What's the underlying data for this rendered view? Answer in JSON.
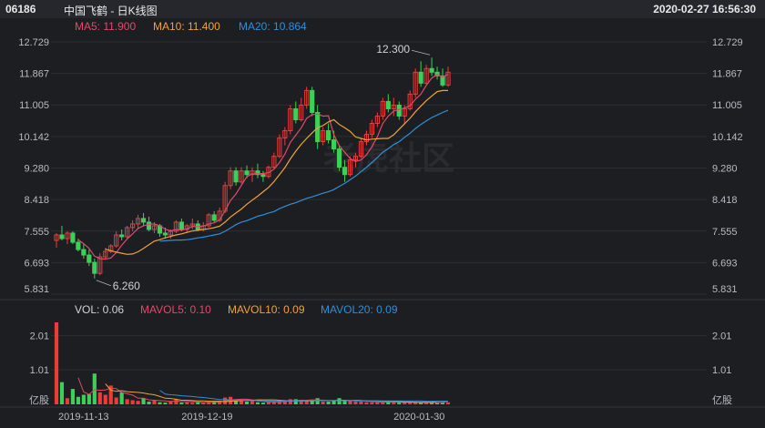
{
  "header": {
    "code": "06186",
    "name": "中国飞鹤 - 日K线图",
    "datetime": "2020-02-27 16:56:30"
  },
  "watermark": "老虎社区",
  "ma_legend": [
    {
      "label": "MA5: 11.900",
      "color": "#e04a6a"
    },
    {
      "label": "MA10: 11.400",
      "color": "#f0a23a"
    },
    {
      "label": "MA20: 10.864",
      "color": "#2f8fd8"
    }
  ],
  "vol_legend": [
    {
      "label": "VOL: 0.06",
      "color": "#cfd3da"
    },
    {
      "label": "MAVOL5: 0.10",
      "color": "#e04a6a"
    },
    {
      "label": "MAVOL10: 0.09",
      "color": "#f0a23a"
    },
    {
      "label": "MAVOL20: 0.09",
      "color": "#2f8fd8"
    }
  ],
  "colors": {
    "up": "#f03a3a",
    "down": "#3ccf5a",
    "grid": "#2c2e33"
  },
  "chart_data": [
    {
      "type": "candlestick",
      "ylim": [
        5.831,
        12.729
      ],
      "yticks": [
        "12.729",
        "11.867",
        "11.005",
        "10.142",
        "9.280",
        "8.418",
        "7.555",
        "6.693",
        "5.831"
      ],
      "xticks": [
        "2019-11-13",
        "2019-12-19",
        "2020-01-30"
      ],
      "annotations": [
        {
          "label": "12.300",
          "index": 69,
          "value": 12.3
        },
        {
          "label": "6.260",
          "index": 7,
          "value": 6.26
        }
      ],
      "ohlc": [
        [
          7.3,
          7.5,
          7.1,
          7.45
        ],
        [
          7.45,
          7.7,
          7.3,
          7.35
        ],
        [
          7.35,
          7.55,
          7.2,
          7.5
        ],
        [
          7.5,
          7.55,
          7.2,
          7.25
        ],
        [
          7.25,
          7.35,
          7.0,
          7.05
        ],
        [
          7.05,
          7.2,
          6.8,
          6.9
        ],
        [
          6.9,
          7.05,
          6.6,
          6.7
        ],
        [
          6.7,
          6.8,
          6.26,
          6.4
        ],
        [
          6.4,
          6.95,
          6.35,
          6.85
        ],
        [
          6.85,
          7.1,
          6.8,
          7.0
        ],
        [
          7.0,
          7.2,
          6.95,
          7.15
        ],
        [
          7.15,
          7.55,
          7.1,
          7.45
        ],
        [
          7.45,
          7.6,
          7.3,
          7.4
        ],
        [
          7.4,
          7.7,
          7.35,
          7.65
        ],
        [
          7.65,
          7.85,
          7.55,
          7.75
        ],
        [
          7.75,
          8.0,
          7.6,
          7.9
        ],
        [
          7.9,
          8.05,
          7.7,
          7.8
        ],
        [
          7.8,
          7.95,
          7.55,
          7.6
        ],
        [
          7.6,
          7.8,
          7.5,
          7.7
        ],
        [
          7.7,
          7.75,
          7.4,
          7.5
        ],
        [
          7.5,
          7.65,
          7.35,
          7.45
        ],
        [
          7.45,
          7.6,
          7.35,
          7.55
        ],
        [
          7.55,
          7.85,
          7.5,
          7.8
        ],
        [
          7.8,
          7.9,
          7.55,
          7.6
        ],
        [
          7.6,
          7.75,
          7.5,
          7.7
        ],
        [
          7.7,
          7.9,
          7.6,
          7.75
        ],
        [
          7.75,
          7.85,
          7.55,
          7.6
        ],
        [
          7.6,
          7.8,
          7.55,
          7.7
        ],
        [
          7.7,
          8.05,
          7.65,
          8.0
        ],
        [
          8.0,
          8.1,
          7.8,
          7.85
        ],
        [
          7.85,
          8.2,
          7.8,
          8.1
        ],
        [
          8.1,
          8.9,
          8.05,
          8.8
        ],
        [
          8.8,
          9.3,
          8.7,
          9.2
        ],
        [
          9.2,
          9.3,
          8.8,
          8.9
        ],
        [
          8.9,
          9.3,
          8.85,
          9.2
        ],
        [
          9.2,
          9.35,
          9.0,
          9.1
        ],
        [
          9.1,
          9.3,
          8.9,
          9.2
        ],
        [
          9.2,
          9.4,
          9.0,
          9.1
        ],
        [
          9.1,
          9.2,
          8.9,
          9.05
        ],
        [
          9.05,
          9.35,
          9.0,
          9.3
        ],
        [
          9.3,
          9.7,
          9.25,
          9.6
        ],
        [
          9.6,
          10.2,
          9.55,
          10.1
        ],
        [
          10.1,
          10.4,
          9.9,
          10.3
        ],
        [
          10.3,
          11.0,
          10.2,
          10.9
        ],
        [
          10.9,
          11.1,
          10.5,
          10.6
        ],
        [
          10.6,
          11.2,
          10.55,
          11.0
        ],
        [
          11.0,
          11.5,
          10.9,
          11.4
        ],
        [
          11.4,
          11.5,
          10.7,
          10.8
        ],
        [
          10.8,
          11.0,
          9.8,
          10.0
        ],
        [
          10.0,
          10.4,
          9.9,
          10.3
        ],
        [
          10.3,
          10.5,
          9.95,
          10.05
        ],
        [
          10.05,
          10.3,
          9.7,
          9.8
        ],
        [
          9.8,
          9.9,
          9.2,
          9.3
        ],
        [
          9.3,
          9.5,
          8.9,
          9.1
        ],
        [
          9.1,
          9.6,
          9.05,
          9.5
        ],
        [
          9.5,
          9.7,
          9.3,
          9.6
        ],
        [
          9.6,
          10.1,
          9.55,
          10.0
        ],
        [
          10.0,
          10.3,
          9.9,
          10.2
        ],
        [
          10.2,
          10.6,
          10.1,
          10.5
        ],
        [
          10.5,
          10.8,
          10.4,
          10.7
        ],
        [
          10.7,
          11.2,
          10.6,
          11.1
        ],
        [
          11.1,
          11.3,
          10.8,
          10.9
        ],
        [
          10.9,
          11.2,
          10.7,
          11.0
        ],
        [
          11.0,
          11.1,
          10.6,
          10.7
        ],
        [
          10.7,
          11.0,
          10.5,
          10.9
        ],
        [
          10.9,
          11.4,
          10.85,
          11.3
        ],
        [
          11.3,
          12.0,
          11.2,
          11.9
        ],
        [
          11.9,
          12.2,
          11.5,
          11.6
        ],
        [
          11.6,
          12.1,
          11.55,
          12.0
        ],
        [
          12.0,
          12.3,
          11.8,
          11.9
        ],
        [
          11.9,
          12.05,
          11.7,
          11.8
        ],
        [
          11.8,
          12.0,
          11.5,
          11.55
        ],
        [
          11.55,
          12.05,
          11.5,
          11.9
        ]
      ],
      "series": [
        {
          "name": "MA5",
          "values": [
            null,
            null,
            null,
            null,
            7.32,
            7.21,
            7.08,
            6.87,
            6.8,
            6.79,
            6.82,
            6.97,
            7.17,
            7.34,
            7.48,
            7.63,
            7.7,
            7.74,
            7.75,
            7.7,
            7.61,
            7.56,
            7.6,
            7.58,
            7.62,
            7.68,
            7.68,
            7.69,
            7.75,
            7.78,
            7.86,
            8.11,
            8.39,
            8.57,
            8.81,
            9.04,
            9.12,
            9.12,
            9.13,
            9.15,
            9.25,
            9.43,
            9.66,
            9.98,
            10.18,
            10.38,
            10.64,
            10.74,
            10.76,
            10.7,
            10.71,
            10.19,
            9.89,
            9.71,
            9.54,
            9.46,
            9.5,
            9.64,
            9.86,
            10.14,
            10.5,
            10.7,
            10.84,
            10.88,
            10.92,
            10.98,
            11.16,
            11.3,
            11.54,
            11.74,
            11.84,
            11.77,
            11.84
          ]
        },
        {
          "name": "MA10",
          "values": [
            null,
            null,
            null,
            null,
            null,
            null,
            null,
            null,
            null,
            7.06,
            7.02,
            6.98,
            6.95,
            6.92,
            6.93,
            6.99,
            7.08,
            7.18,
            7.28,
            7.32,
            7.37,
            7.41,
            7.45,
            7.48,
            7.52,
            7.56,
            7.58,
            7.6,
            7.62,
            7.65,
            7.69,
            7.8,
            7.94,
            8.05,
            8.16,
            8.29,
            8.4,
            8.51,
            8.63,
            8.75,
            8.91,
            9.1,
            9.29,
            9.53,
            9.74,
            9.93,
            10.09,
            10.24,
            10.38,
            10.44,
            10.54,
            10.6,
            10.47,
            10.38,
            10.28,
            10.13,
            10.09,
            10.05,
            10.07,
            10.08,
            10.09,
            10.09,
            10.19,
            10.34,
            10.49,
            10.64,
            10.82,
            10.97,
            11.12,
            11.25,
            11.37,
            11.4,
            11.4
          ]
        },
        {
          "name": "MA20",
          "values": [
            null,
            null,
            null,
            null,
            null,
            null,
            null,
            null,
            null,
            null,
            null,
            null,
            null,
            null,
            null,
            null,
            null,
            null,
            null,
            7.28,
            7.29,
            7.3,
            7.31,
            7.31,
            7.32,
            7.34,
            7.37,
            7.39,
            7.42,
            7.45,
            7.48,
            7.55,
            7.64,
            7.73,
            7.8,
            7.84,
            7.9,
            7.96,
            8.0,
            8.05,
            8.09,
            8.17,
            8.23,
            8.29,
            8.33,
            8.39,
            8.45,
            8.49,
            8.54,
            8.59,
            8.63,
            8.69,
            8.78,
            8.86,
            8.96,
            9.06,
            9.18,
            9.3,
            9.43,
            9.57,
            9.71,
            9.81,
            9.92,
            10.0,
            10.12,
            10.23,
            10.36,
            10.47,
            10.57,
            10.66,
            10.73,
            10.8,
            10.86
          ]
        }
      ]
    },
    {
      "type": "bar",
      "ylim": [
        0,
        2.4
      ],
      "yticks": [
        "2.01",
        "1.01"
      ],
      "yunit": "亿股",
      "volume": [
        2.4,
        0.65,
        0.18,
        0.45,
        0.22,
        0.28,
        0.3,
        0.9,
        0.35,
        0.28,
        0.55,
        0.2,
        0.35,
        0.15,
        0.12,
        0.1,
        0.18,
        0.08,
        0.12,
        0.06,
        0.05,
        0.1,
        0.15,
        0.05,
        0.06,
        0.05,
        0.06,
        0.05,
        0.06,
        0.08,
        0.1,
        0.2,
        0.22,
        0.1,
        0.15,
        0.08,
        0.1,
        0.06,
        0.05,
        0.08,
        0.07,
        0.1,
        0.1,
        0.15,
        0.15,
        0.12,
        0.1,
        0.12,
        0.18,
        0.08,
        0.08,
        0.1,
        0.18,
        0.12,
        0.1,
        0.08,
        0.08,
        0.06,
        0.06,
        0.06,
        0.06,
        0.1,
        0.05,
        0.05,
        0.05,
        0.05,
        0.06,
        0.05,
        0.06,
        0.05,
        0.05,
        0.05,
        0.06
      ],
      "series": [
        {
          "name": "MAVOL5",
          "values": [
            null,
            null,
            null,
            null,
            0.78,
            0.36,
            0.29,
            0.43,
            0.41,
            0.42,
            0.48,
            0.46,
            0.35,
            0.31,
            0.27,
            0.18,
            0.18,
            0.13,
            0.12,
            0.11,
            0.1,
            0.08,
            0.1,
            0.08,
            0.08,
            0.08,
            0.07,
            0.05,
            0.06,
            0.06,
            0.07,
            0.09,
            0.13,
            0.14,
            0.15,
            0.15,
            0.13,
            0.1,
            0.09,
            0.07,
            0.07,
            0.07,
            0.08,
            0.1,
            0.11,
            0.12,
            0.12,
            0.13,
            0.13,
            0.12,
            0.11,
            0.11,
            0.11,
            0.11,
            0.11,
            0.12,
            0.11,
            0.09,
            0.08,
            0.07,
            0.06,
            0.07,
            0.07,
            0.07,
            0.06,
            0.06,
            0.06,
            0.05,
            0.05,
            0.05,
            0.05,
            0.05,
            0.1
          ]
        },
        {
          "name": "MAVOL10",
          "values": [
            null,
            null,
            null,
            null,
            null,
            null,
            null,
            null,
            null,
            0.6,
            0.42,
            0.38,
            0.4,
            0.37,
            0.36,
            0.35,
            0.33,
            0.3,
            0.28,
            0.23,
            0.18,
            0.17,
            0.15,
            0.12,
            0.12,
            0.11,
            0.1,
            0.1,
            0.09,
            0.09,
            0.09,
            0.08,
            0.09,
            0.1,
            0.11,
            0.12,
            0.12,
            0.13,
            0.13,
            0.13,
            0.13,
            0.12,
            0.11,
            0.1,
            0.1,
            0.1,
            0.1,
            0.1,
            0.11,
            0.11,
            0.11,
            0.11,
            0.12,
            0.12,
            0.11,
            0.11,
            0.11,
            0.1,
            0.1,
            0.1,
            0.09,
            0.09,
            0.08,
            0.08,
            0.07,
            0.07,
            0.06,
            0.06,
            0.06,
            0.06,
            0.09,
            0.09,
            0.09
          ]
        },
        {
          "name": "MAVOL20",
          "values": [
            null,
            null,
            null,
            null,
            null,
            null,
            null,
            null,
            null,
            null,
            null,
            null,
            null,
            null,
            null,
            null,
            null,
            null,
            null,
            0.41,
            0.3,
            0.28,
            0.27,
            0.25,
            0.24,
            0.23,
            0.21,
            0.2,
            0.18,
            0.16,
            0.14,
            0.14,
            0.13,
            0.12,
            0.12,
            0.11,
            0.11,
            0.11,
            0.1,
            0.1,
            0.1,
            0.1,
            0.1,
            0.1,
            0.1,
            0.1,
            0.11,
            0.11,
            0.11,
            0.11,
            0.11,
            0.11,
            0.11,
            0.11,
            0.11,
            0.1,
            0.1,
            0.1,
            0.1,
            0.1,
            0.1,
            0.1,
            0.1,
            0.1,
            0.1,
            0.1,
            0.1,
            0.1,
            0.09,
            0.09,
            0.09,
            0.09,
            0.09
          ]
        }
      ]
    }
  ]
}
